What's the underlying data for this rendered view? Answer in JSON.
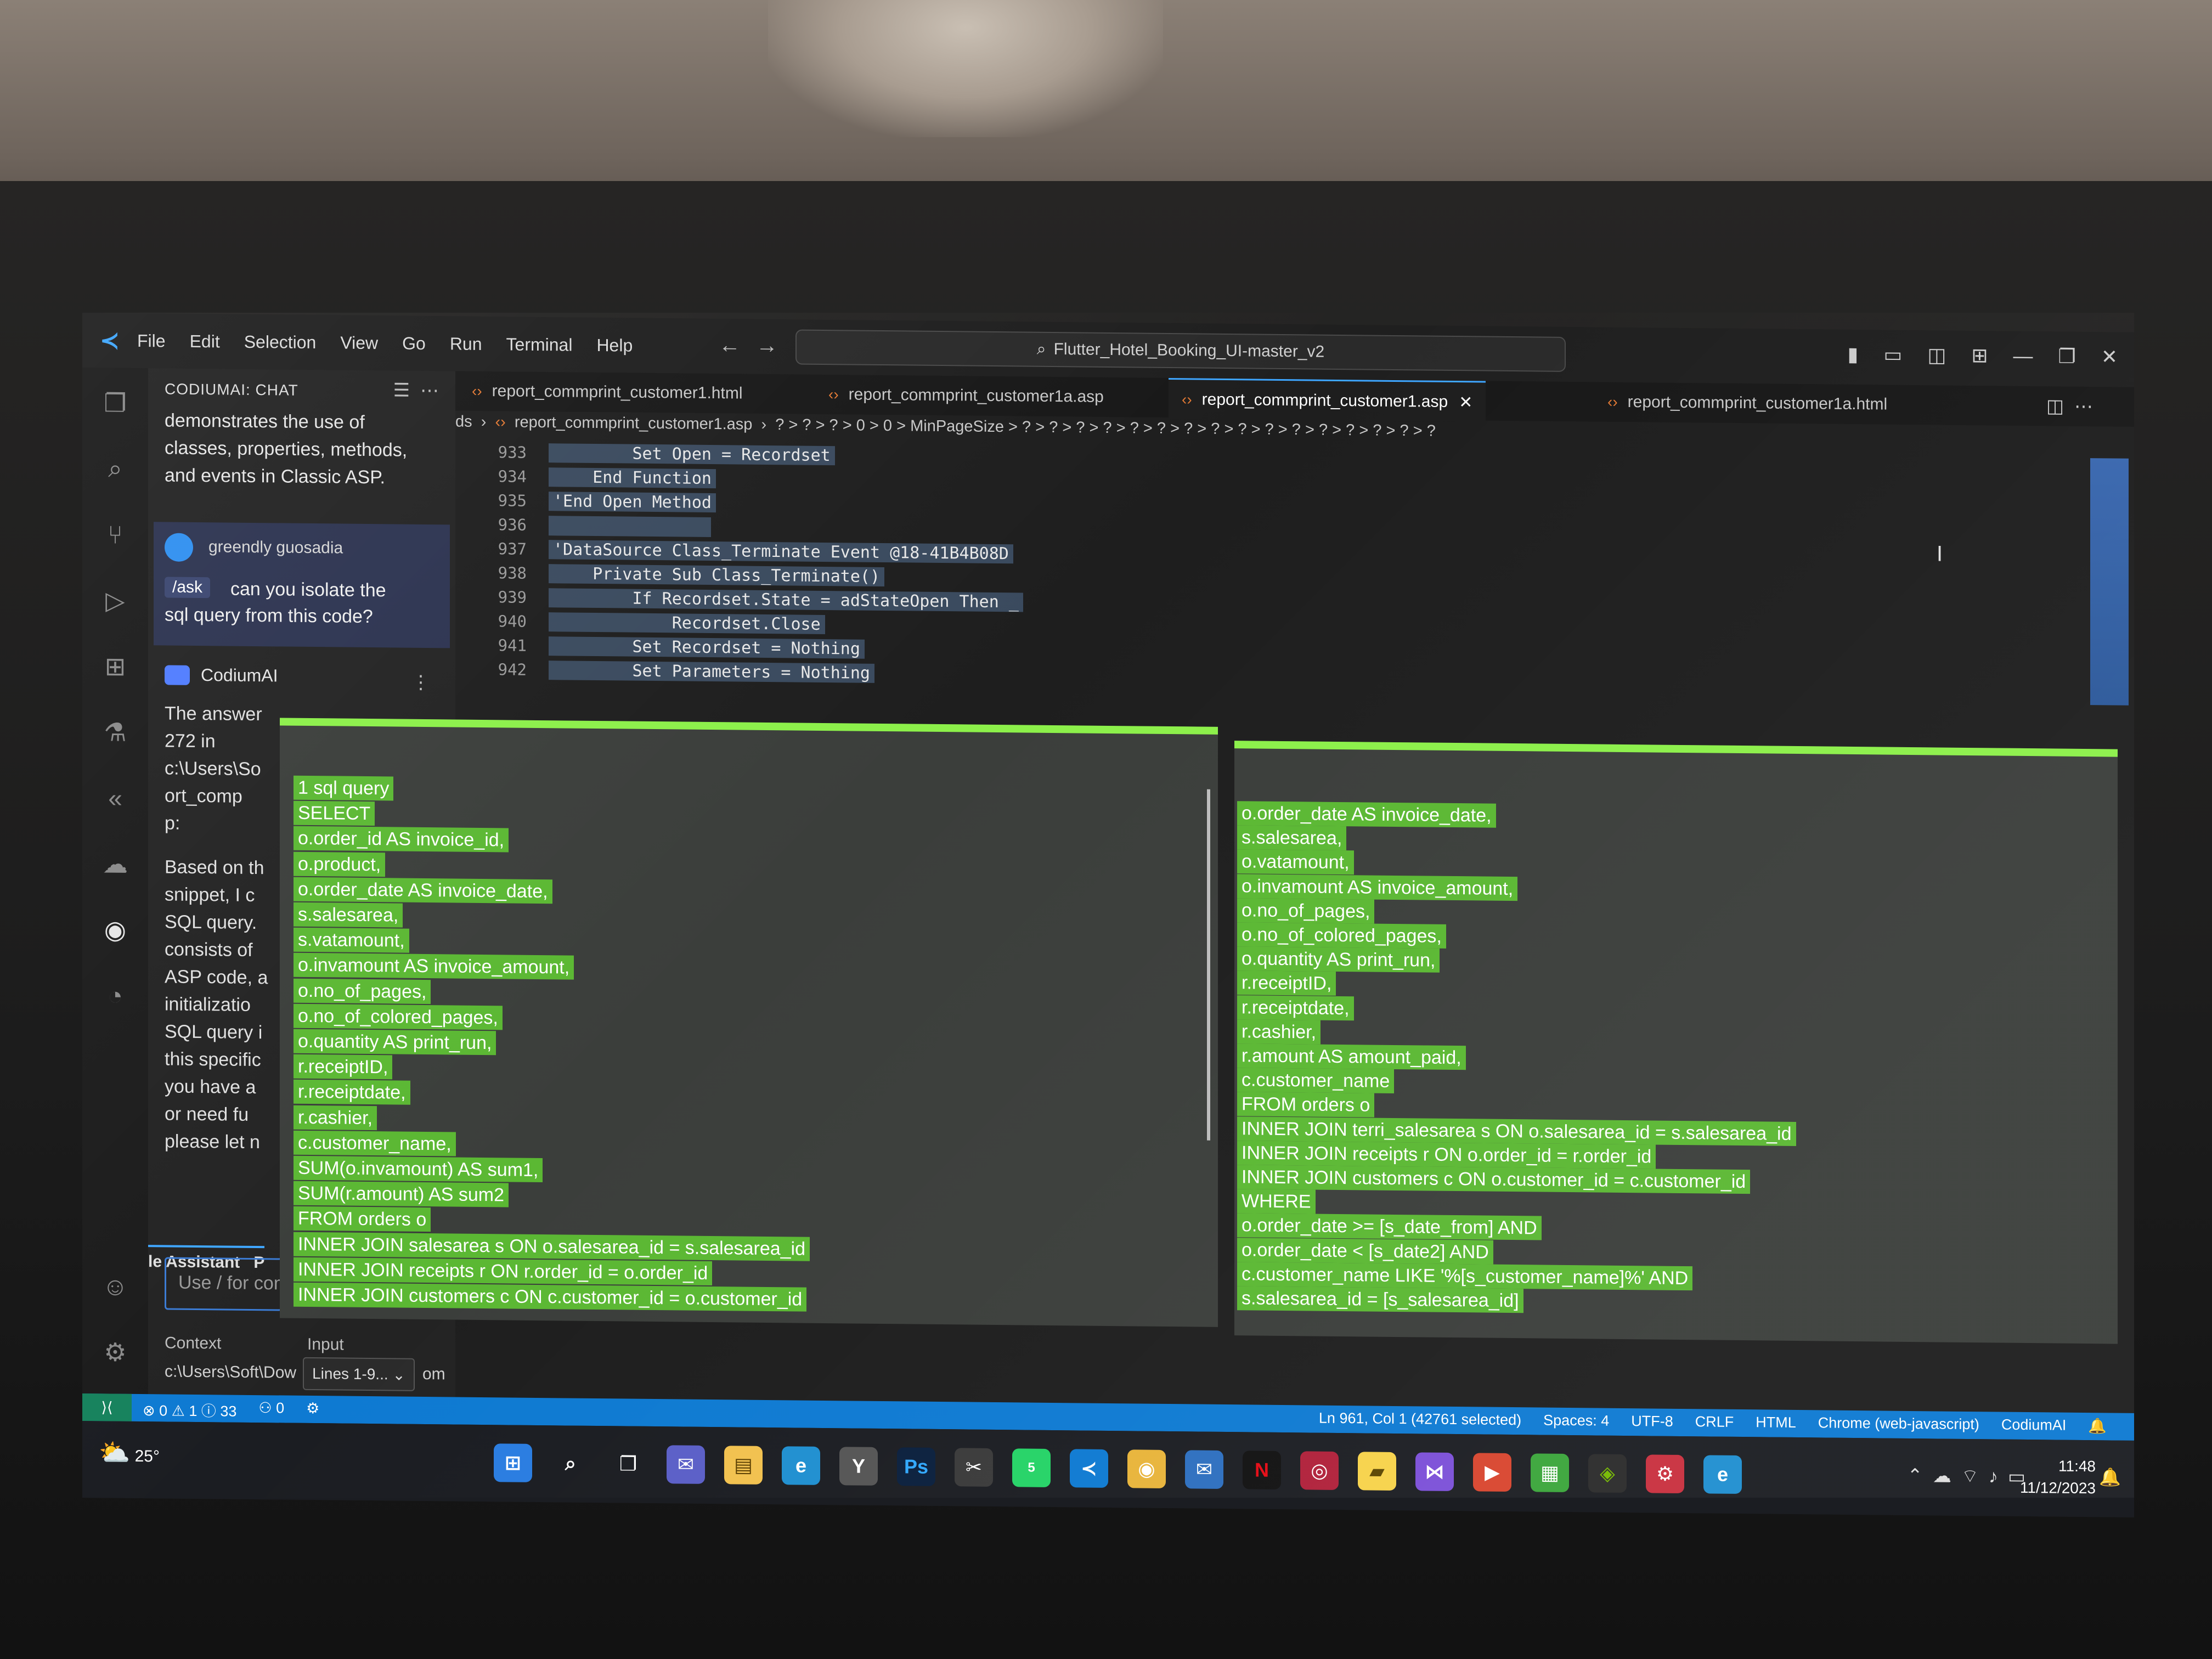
{
  "menu": [
    "File",
    "Edit",
    "Selection",
    "View",
    "Go",
    "Run",
    "Terminal",
    "Help"
  ],
  "search": {
    "title": "Flutter_Hotel_Booking_UI-master_v2"
  },
  "chat": {
    "header": "CODIUMAI: CHAT",
    "intro_lines": [
      "demonstrates the use of",
      "classes, properties, methods,",
      "and events in Classic ASP."
    ],
    "user_name": "greendly guosadia",
    "ask_tag": "/ask",
    "user_msg_1": "can you isolate the",
    "user_msg_2": "sql query from this code?",
    "assistant_name": "CodiumAI",
    "answer_lines": [
      "The answer",
      "272 in",
      "c:\\Users\\So",
      "ort_comp",
      "p:",
      "",
      "Based on th",
      "snippet, I c",
      "SQL query.",
      "consists of",
      "ASP code, a",
      "initializatio",
      "SQL query i",
      "this specific",
      "you have a",
      "or need fu",
      "please let n"
    ],
    "tab_label": "le Assistant",
    "tab_label_2": "P",
    "input_placeholder": "Use / for commands or",
    "context_label": "Context",
    "input_label": "Input",
    "context_path": "c:\\Users\\Soft\\Dow",
    "lines_select": "Lines 1-9...",
    "om": "om"
  },
  "tabs": [
    {
      "label": "report_commprint_customer1.html",
      "active": false
    },
    {
      "label": "report_commprint_customer1a.asp",
      "active": false
    },
    {
      "label": "report_commprint_customer1.asp",
      "active": true
    },
    {
      "label": "report_commprint_customer1a.html",
      "active": false
    }
  ],
  "breadcrumbs": {
    "root": "ds",
    "file": "report_commprint_customer1.asp",
    "trail": "? > ? > ? > 0 > 0 > MinPageSize > ? > ? > ? > ? > ? > ? > ? > ? > ? > ? > ? > ? > ? > ? > ? > ?"
  },
  "code": {
    "line_numbers": [
      "933",
      "934",
      "935",
      "936",
      "937",
      "938",
      "939",
      "940",
      "941",
      "942"
    ],
    "lines": [
      "        Set Open = Recordset",
      "    End Function",
      "'End Open Method",
      "",
      "'DataSource Class_Terminate Event @18-41B4B08D",
      "    Private Sub Class_Terminate()",
      "        If Recordset.State = adStateOpen Then _",
      "            Recordset.Close",
      "        Set Recordset = Nothing",
      "        Set Parameters = Nothing"
    ]
  },
  "sql_left": [
    "1 sql query",
    "SELECT",
    "  o.order_id AS invoice_id,",
    "  o.product,",
    "  o.order_date AS invoice_date,",
    "  s.salesarea,",
    "  s.vatamount,",
    "  o.invamount AS invoice_amount,",
    "  o.no_of_pages,",
    "  o.no_of_colored_pages,",
    "  o.quantity AS print_run,",
    "  r.receiptID,",
    "  r.receiptdate,",
    "  r.cashier,",
    "  c.customer_name,",
    "  SUM(o.invamount) AS sum1,",
    "  SUM(r.amount) AS sum2",
    "FROM orders o",
    "INNER JOIN salesarea s ON o.salesarea_id = s.salesarea_id",
    "INNER JOIN receipts r ON r.order_id = o.order_id",
    "INNER JOIN customers c ON c.customer_id = o.customer_id"
  ],
  "sql_right": [
    "  o.order_date AS invoice_date,",
    "  s.salesarea,",
    "  o.vatamount,",
    "  o.invamount AS invoice_amount,",
    "  o.no_of_pages,",
    "  o.no_of_colored_pages,",
    "  o.quantity AS print_run,",
    "  r.receiptID,",
    "  r.receiptdate,",
    "  r.cashier,",
    "  r.amount AS amount_paid,",
    "  c.customer_name",
    "FROM orders o",
    "INNER JOIN terri_salesarea s ON o.salesarea_id = s.salesarea_id",
    "INNER JOIN receipts r ON o.order_id = r.order_id",
    "INNER JOIN customers c ON o.customer_id = c.customer_id",
    "WHERE",
    "  o.order_date >= [s_date_from] AND",
    "  o.order_date < [s_date2] AND",
    "  c.customer_name LIKE '%[s_customer_name]%' AND",
    "  s.salesarea_id = [s_salesarea_id]"
  ],
  "status": {
    "problems": "⊗ 0 ⚠ 1 ⓘ 33",
    "ports": "0",
    "position": "Ln 961, Col 1 (42761 selected)",
    "spaces": "Spaces: 4",
    "encoding": "UTF-8",
    "eol": "CRLF",
    "language": "HTML",
    "debug": "Chrome (web-javascript)",
    "ext": "CodiumAI"
  },
  "taskbar": {
    "temp": "25°",
    "time": "11:48",
    "date": "11/12/2023",
    "whatsapp_badge": "5"
  }
}
